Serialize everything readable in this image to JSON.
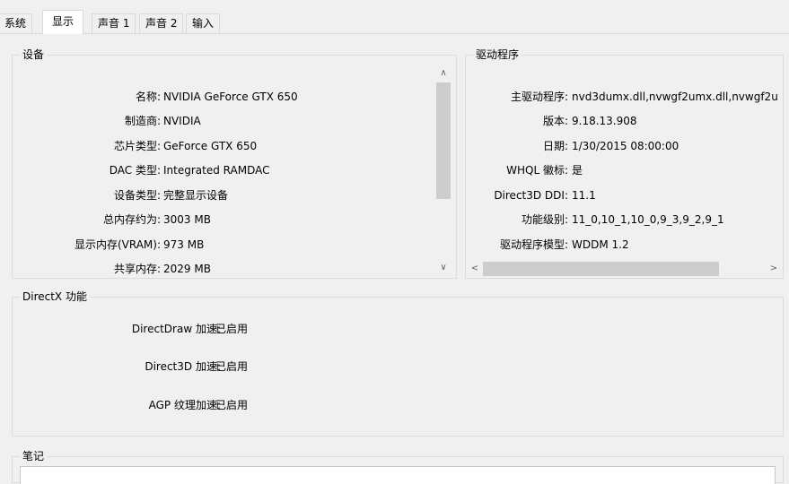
{
  "tabs": [
    "系统",
    "显示",
    "声音 1",
    "声音 2",
    "输入"
  ],
  "device": {
    "title": "设备",
    "rows": [
      {
        "label": "名称:",
        "value": "NVIDIA GeForce GTX 650"
      },
      {
        "label": "制造商:",
        "value": "NVIDIA"
      },
      {
        "label": "芯片类型:",
        "value": "GeForce GTX 650"
      },
      {
        "label": "DAC 类型:",
        "value": "Integrated RAMDAC"
      },
      {
        "label": "设备类型:",
        "value": "完整显示设备"
      },
      {
        "label": "总内存约为:",
        "value": "3003 MB"
      },
      {
        "label": "显示内存(VRAM):",
        "value": "973 MB"
      },
      {
        "label": "共享内存:",
        "value": "2029 MB"
      }
    ]
  },
  "driver": {
    "title": "驱动程序",
    "rows": [
      {
        "label": "主驱动程序:",
        "value": "nvd3dumx.dll,nvwgf2umx.dll,nvwgf2u"
      },
      {
        "label": "版本:",
        "value": "9.18.13.908"
      },
      {
        "label": "日期:",
        "value": "1/30/2015 08:00:00"
      },
      {
        "label": "WHQL 徽标:",
        "value": "是"
      },
      {
        "label": "Direct3D DDI:",
        "value": "11.1"
      },
      {
        "label": "功能级别:",
        "value": "11_0,10_1,10_0,9_3,9_2,9_1"
      },
      {
        "label": "驱动程序模型:",
        "value": "WDDM 1.2"
      }
    ]
  },
  "directx": {
    "title": "DirectX 功能",
    "rows": [
      {
        "label": "DirectDraw 加速:",
        "value": "已启用"
      },
      {
        "label": "Direct3D 加速:",
        "value": "已启用"
      },
      {
        "label": "AGP 纹理加速:",
        "value": "已启用"
      }
    ]
  },
  "notes": {
    "title": "笔记"
  },
  "glyphs": {
    "up": "∧",
    "down": "∨",
    "left": "<",
    "right": ">"
  }
}
